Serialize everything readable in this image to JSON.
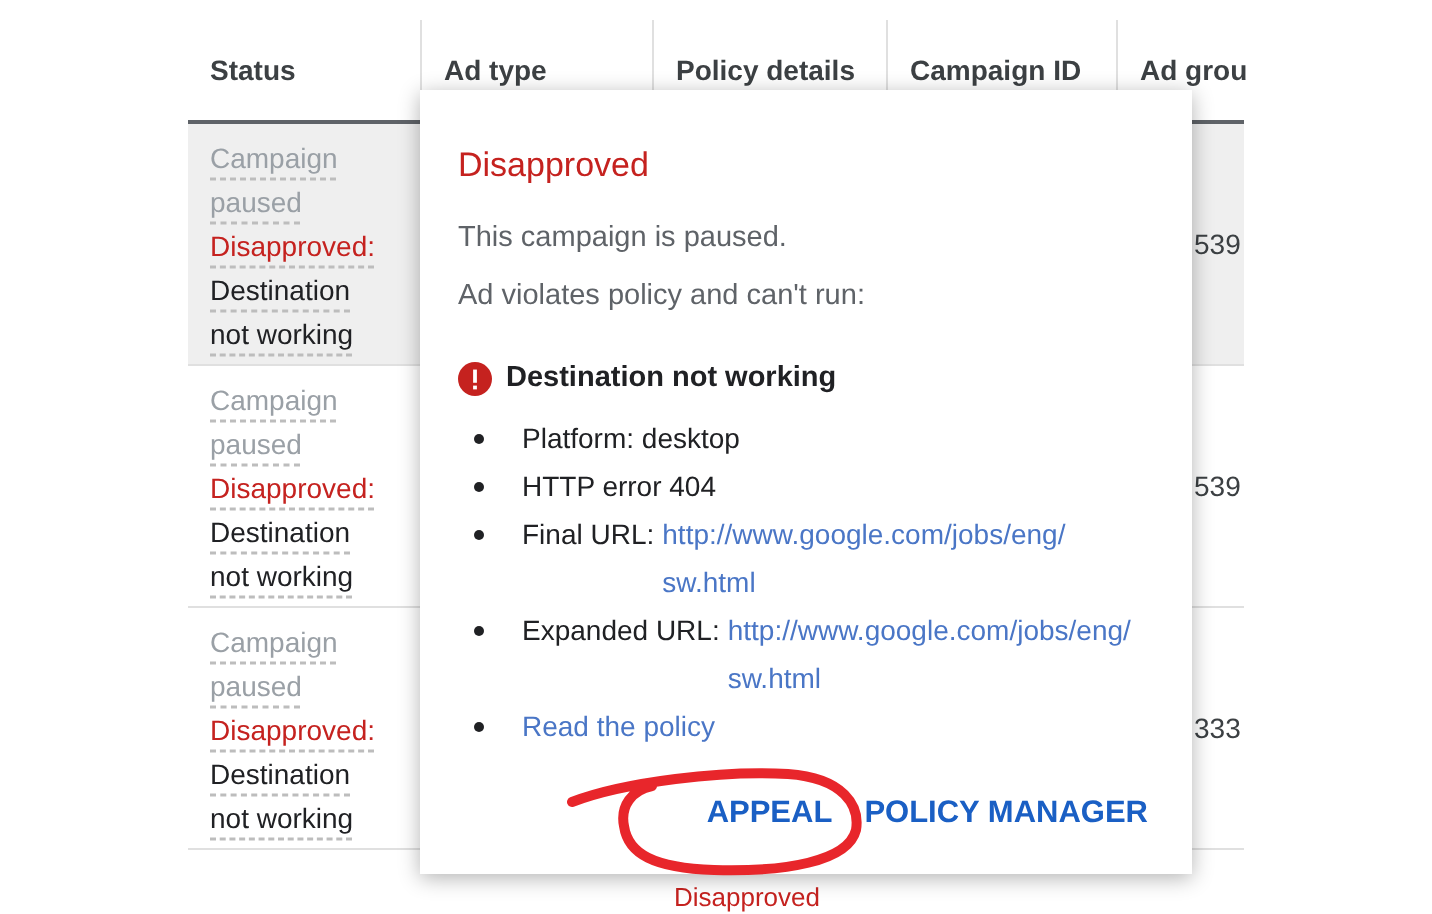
{
  "table": {
    "columns": [
      "Status",
      "Ad type",
      "Policy details",
      "Campaign ID",
      "Ad grou"
    ],
    "rows": [
      {
        "highlighted": true,
        "status": "Campaign paused",
        "approval": "Disapproved:",
        "reason": "Destination not working",
        "column_5": "539"
      },
      {
        "highlighted": false,
        "status": "Campaign paused",
        "approval": "Disapproved:",
        "reason": "Destination not working",
        "column_5": "539"
      },
      {
        "highlighted": false,
        "status": "Campaign paused",
        "approval": "Disapproved:",
        "reason": "Destination not working",
        "column_5": "333"
      }
    ],
    "partial_row": {
      "policy_details": "Disapproved"
    }
  },
  "popup": {
    "title": "Disapproved",
    "lines": [
      "This campaign is paused.",
      "Ad violates policy and can't run:"
    ],
    "issue": {
      "title": "Destination not working",
      "details": [
        {
          "kind": "text",
          "text": "Platform: desktop"
        },
        {
          "kind": "text",
          "text": "HTTP error 404"
        },
        {
          "kind": "url",
          "label": "Final URL:",
          "url": "http://www.google.com/jobs/eng/sw.html"
        },
        {
          "kind": "url",
          "label": "Expanded URL:",
          "url": "http://www.google.com/jobs/eng/sw.html"
        },
        {
          "kind": "link",
          "text": "Read the policy"
        }
      ]
    },
    "buttons": [
      "APPEAL",
      "POLICY MANAGER"
    ]
  }
}
